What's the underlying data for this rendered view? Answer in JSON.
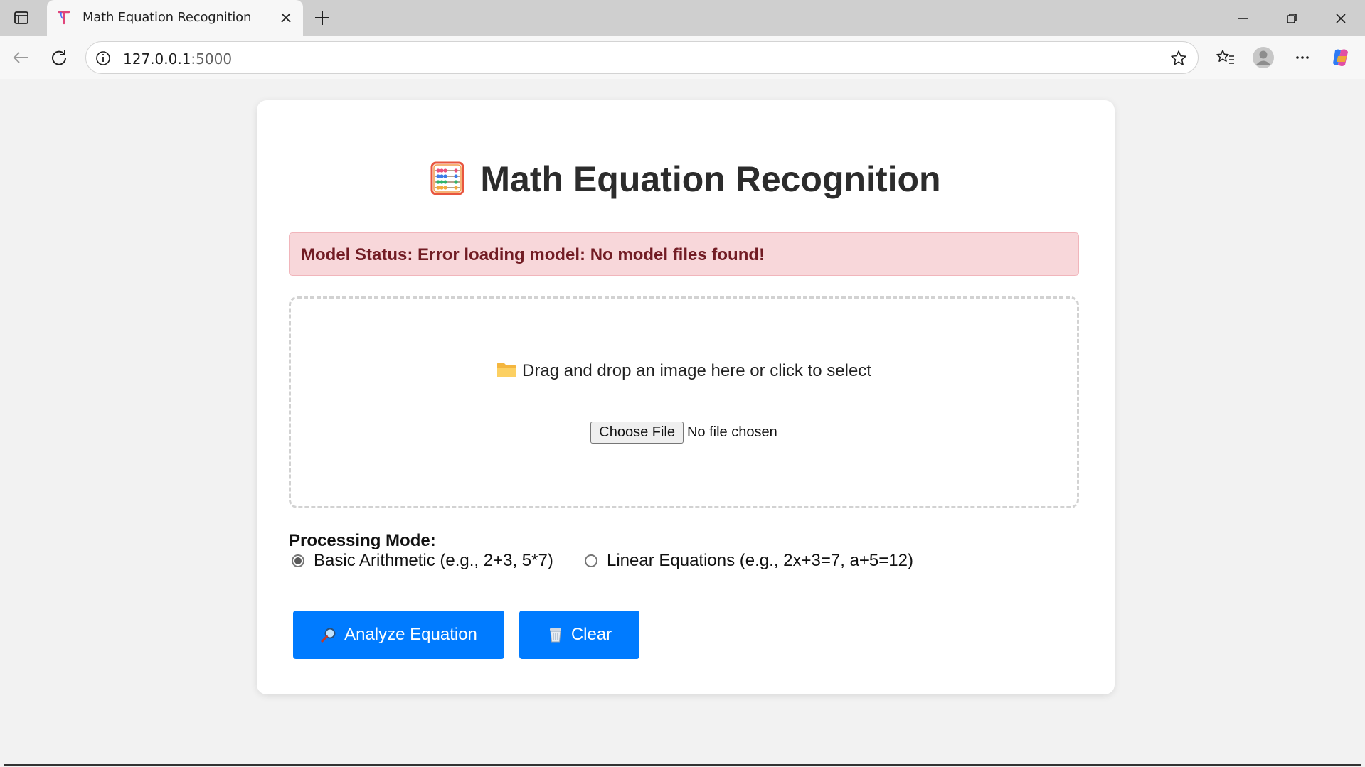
{
  "browser": {
    "tab_title": "Math Equation Recognition",
    "url_host": "127.0.0.1",
    "url_port": ":5000"
  },
  "page": {
    "title": "Math Equation Recognition",
    "status_message": "Model Status: Error loading model: No model files found!",
    "dropzone_text": "Drag and drop an image here or click to select",
    "file_button_label": "Choose File",
    "file_status": "No file chosen",
    "processing_mode_label": "Processing Mode:",
    "modes": [
      {
        "label": "Basic Arithmetic (e.g., 2+3, 5*7)",
        "checked": true
      },
      {
        "label": "Linear Equations (e.g., 2x+3=7, a+5=12)",
        "checked": false
      }
    ],
    "analyze_button": "Analyze Equation",
    "clear_button": "Clear"
  },
  "colors": {
    "primary": "#007bff",
    "error_bg": "#f8d7da",
    "error_text": "#721c24"
  }
}
